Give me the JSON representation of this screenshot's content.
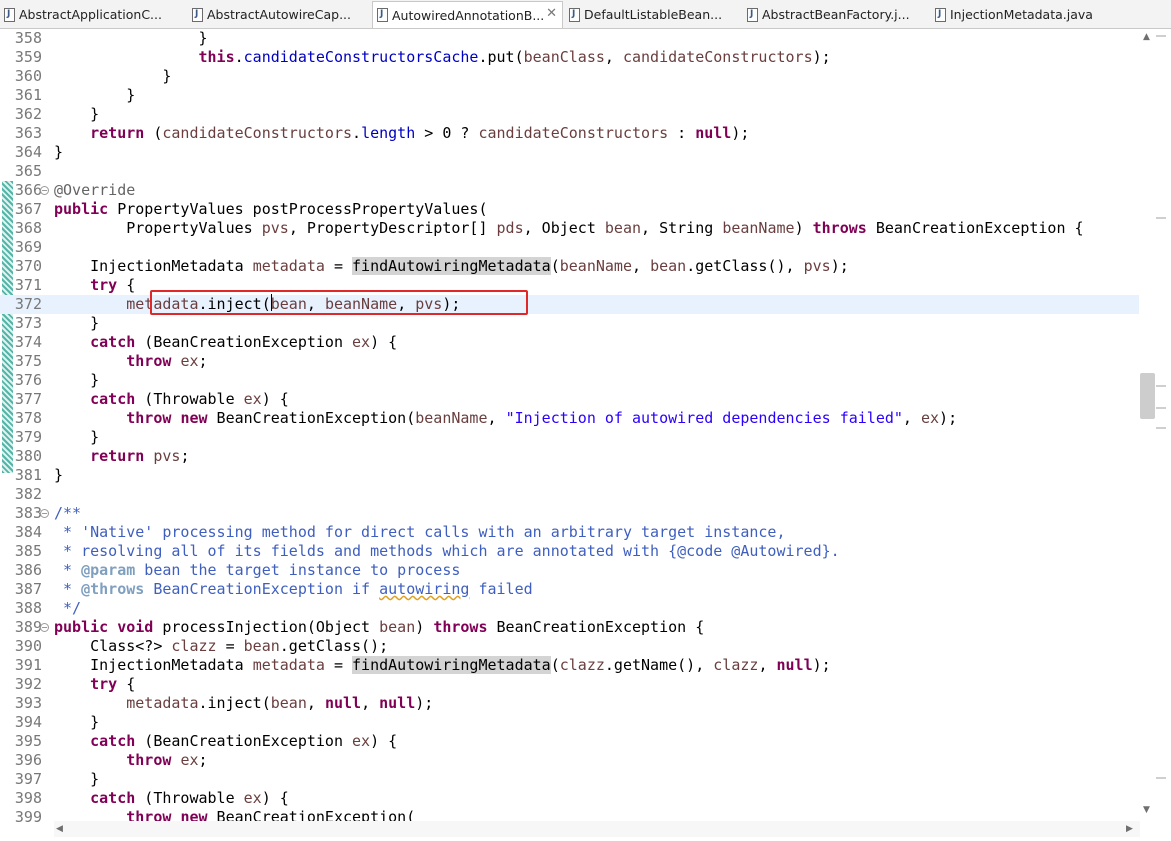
{
  "tabs": [
    {
      "label": "AbstractApplicationC...",
      "active": false
    },
    {
      "label": "AbstractAutowireCap...",
      "active": false
    },
    {
      "label": "AutowiredAnnotationB...",
      "active": true
    },
    {
      "label": "DefaultListableBean...",
      "active": false
    },
    {
      "label": "AbstractBeanFactory.j...",
      "active": false
    },
    {
      "label": "InjectionMetadata.java",
      "active": false
    }
  ],
  "tab_close_glyph": "✕",
  "editor": {
    "current_line": "372",
    "highlight_box_line": "372",
    "lines": [
      {
        "n": "358",
        "fold": "",
        "html": "                }"
      },
      {
        "n": "359",
        "fold": "",
        "html": "                <span class=\"k\">this</span>.<span class=\"f\">candidateConstructorsCache</span>.put(<span class=\"v\">beanClass</span>, <span class=\"v\">candidateConstructors</span>);"
      },
      {
        "n": "360",
        "fold": "",
        "html": "            }"
      },
      {
        "n": "361",
        "fold": "",
        "html": "        }"
      },
      {
        "n": "362",
        "fold": "",
        "html": "    }"
      },
      {
        "n": "363",
        "fold": "",
        "html": "    <span class=\"k\">return</span> (<span class=\"v\">candidateConstructors</span>.<span class=\"f\">length</span> &gt; 0 ? <span class=\"v\">candidateConstructors</span> : <span class=\"k\">null</span>);"
      },
      {
        "n": "364",
        "fold": "",
        "html": "}"
      },
      {
        "n": "365",
        "fold": "",
        "html": ""
      },
      {
        "n": "366",
        "fold": "−",
        "html": "<span class=\"a\">@Override</span>"
      },
      {
        "n": "367",
        "fold": "",
        "html": "<span class=\"k\">public</span> PropertyValues postProcessPropertyValues("
      },
      {
        "n": "368",
        "fold": "",
        "html": "        PropertyValues <span class=\"v\">pvs</span>, PropertyDescriptor[] <span class=\"v\">pds</span>, Object <span class=\"v\">bean</span>, String <span class=\"v\">beanName</span>) <span class=\"k\">throws</span> BeanCreationException {"
      },
      {
        "n": "369",
        "fold": "",
        "html": ""
      },
      {
        "n": "370",
        "fold": "",
        "html": "    InjectionMetadata <span class=\"v\">metadata</span> = <span class=\"h\">findAutowiringMetadata</span>(<span class=\"v\">beanName</span>, <span class=\"v\">bean</span>.getClass(), <span class=\"v\">pvs</span>);"
      },
      {
        "n": "371",
        "fold": "",
        "html": "    <span class=\"k\">try</span> {"
      },
      {
        "n": "372",
        "fold": "",
        "html": "        <span class=\"v\">metadata</span>.inject(<span class=\"v\">bean</span>, <span class=\"v\">beanName</span>, <span class=\"v\">pvs</span>);"
      },
      {
        "n": "373",
        "fold": "",
        "html": "    }"
      },
      {
        "n": "374",
        "fold": "",
        "html": "    <span class=\"k\">catch</span> (BeanCreationException <span class=\"v\">ex</span>) {"
      },
      {
        "n": "375",
        "fold": "",
        "html": "        <span class=\"k\">throw</span> <span class=\"v\">ex</span>;"
      },
      {
        "n": "376",
        "fold": "",
        "html": "    }"
      },
      {
        "n": "377",
        "fold": "",
        "html": "    <span class=\"k\">catch</span> (Throwable <span class=\"v\">ex</span>) {"
      },
      {
        "n": "378",
        "fold": "",
        "html": "        <span class=\"k\">throw</span> <span class=\"k\">new</span> BeanCreationException(<span class=\"v\">beanName</span>, <span class=\"s\">\"Injection of autowired dependencies failed\"</span>, <span class=\"v\">ex</span>);"
      },
      {
        "n": "379",
        "fold": "",
        "html": "    }"
      },
      {
        "n": "380",
        "fold": "",
        "html": "    <span class=\"k\">return</span> <span class=\"v\">pvs</span>;"
      },
      {
        "n": "381",
        "fold": "",
        "html": "}"
      },
      {
        "n": "382",
        "fold": "",
        "html": ""
      },
      {
        "n": "383",
        "fold": "−",
        "html": "<span class=\"c\">/**</span>"
      },
      {
        "n": "384",
        "fold": "",
        "html": "<span class=\"c\"> * 'Native' processing method for direct calls with an arbitrary target instance,</span>"
      },
      {
        "n": "385",
        "fold": "",
        "html": "<span class=\"c\"> * resolving all of its fields and methods which are annotated with {@code @Autowired}.</span>"
      },
      {
        "n": "386",
        "fold": "",
        "html": "<span class=\"c\"> * </span><span class=\"t\">@param</span><span class=\"c\"> bean the target instance to process</span>"
      },
      {
        "n": "387",
        "fold": "",
        "html": "<span class=\"c\"> * </span><span class=\"t\">@throws</span><span class=\"c\"> BeanCreationException if </span><span class=\"c u\">autowiring</span><span class=\"c\"> failed</span>"
      },
      {
        "n": "388",
        "fold": "",
        "html": "<span class=\"c\"> */</span>"
      },
      {
        "n": "389",
        "fold": "−",
        "html": "<span class=\"k\">public</span> <span class=\"k\">void</span> processInjection(Object <span class=\"v\">bean</span>) <span class=\"k\">throws</span> BeanCreationException {"
      },
      {
        "n": "390",
        "fold": "",
        "html": "    Class&lt;?&gt; <span class=\"v\">clazz</span> = <span class=\"v\">bean</span>.getClass();"
      },
      {
        "n": "391",
        "fold": "",
        "html": "    InjectionMetadata <span class=\"v\">metadata</span> = <span class=\"h\">findAutowiringMetadata</span>(<span class=\"v\">clazz</span>.getName(), <span class=\"v\">clazz</span>, <span class=\"k\">null</span>);"
      },
      {
        "n": "392",
        "fold": "",
        "html": "    <span class=\"k\">try</span> {"
      },
      {
        "n": "393",
        "fold": "",
        "html": "        <span class=\"v\">metadata</span>.inject(<span class=\"v\">bean</span>, <span class=\"k\">null</span>, <span class=\"k\">null</span>);"
      },
      {
        "n": "394",
        "fold": "",
        "html": "    }"
      },
      {
        "n": "395",
        "fold": "",
        "html": "    <span class=\"k\">catch</span> (BeanCreationException <span class=\"v\">ex</span>) {"
      },
      {
        "n": "396",
        "fold": "",
        "html": "        <span class=\"k\">throw</span> <span class=\"v\">ex</span>;"
      },
      {
        "n": "397",
        "fold": "",
        "html": "    }"
      },
      {
        "n": "398",
        "fold": "",
        "html": "    <span class=\"k\">catch</span> (Throwable <span class=\"v\">ex</span>) {"
      },
      {
        "n": "399",
        "fold": "",
        "html": "        <span class=\"k\">throw</span> <span class=\"k\">new</span> BeanCreationException("
      }
    ]
  },
  "scrollbar_arrows": {
    "up": "▲",
    "down": "▼",
    "left": "◀",
    "right": "▶"
  }
}
